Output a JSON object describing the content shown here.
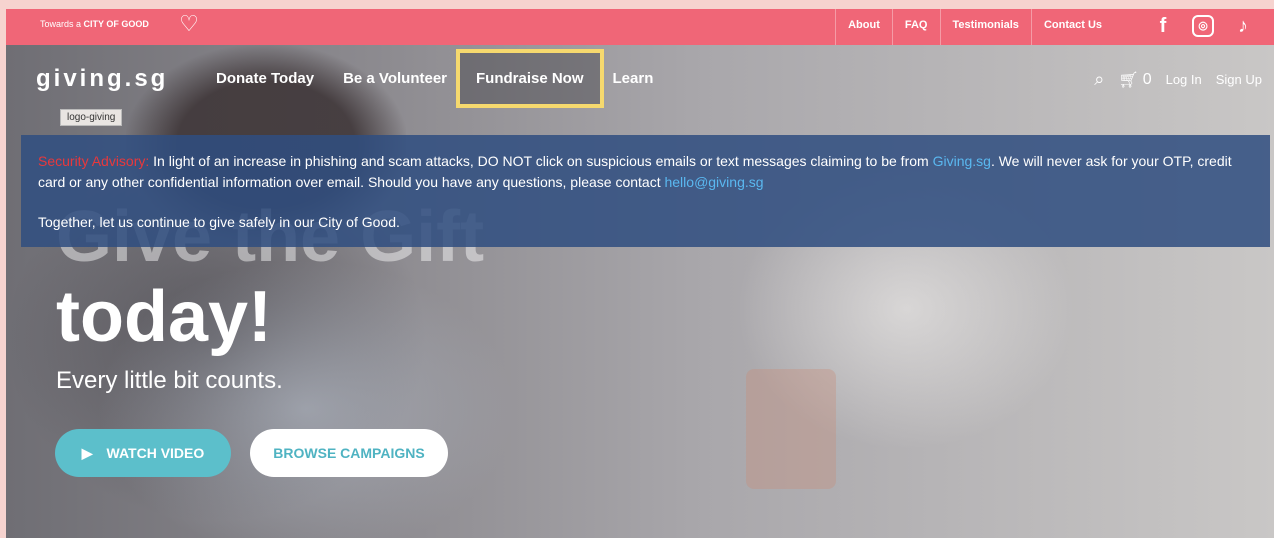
{
  "topbar": {
    "tagline_prefix": "Towards a",
    "tagline_bold": "CITY OF GOOD",
    "links": [
      "About",
      "FAQ",
      "Testimonials",
      "Contact Us"
    ]
  },
  "nav": {
    "logo": "giving.sg",
    "logo_tag": "logo-giving",
    "items": [
      "Donate Today",
      "Be a Volunteer",
      "Fundraise Now",
      "Learn"
    ],
    "cart_count": "0",
    "login": "Log In",
    "signup": "Sign Up"
  },
  "advisory": {
    "label": "Security Advisory:",
    "text1": " In light of an increase in phishing and scam attacks, DO NOT click on suspicious emails or text messages claiming to be from ",
    "link1": "Giving.sg",
    "text2": ". We will never ask for your OTP, credit card or any other confidential information over email. Should you have any questions, please contact ",
    "link2": "hello@giving.sg",
    "line2": "Together, let us continue to give safely in our City of Good."
  },
  "hero": {
    "title_line1": "Give the Gift",
    "title_line2": "today!",
    "subtitle": "Every little bit counts.",
    "watch_label": "WATCH VIDEO",
    "browse_label": "BROWSE CAMPAIGNS"
  },
  "colors": {
    "topbar": "#f06677",
    "highlight": "#f6d96e",
    "advisory_bg": "#304e80",
    "accent": "#5cbfcb"
  }
}
